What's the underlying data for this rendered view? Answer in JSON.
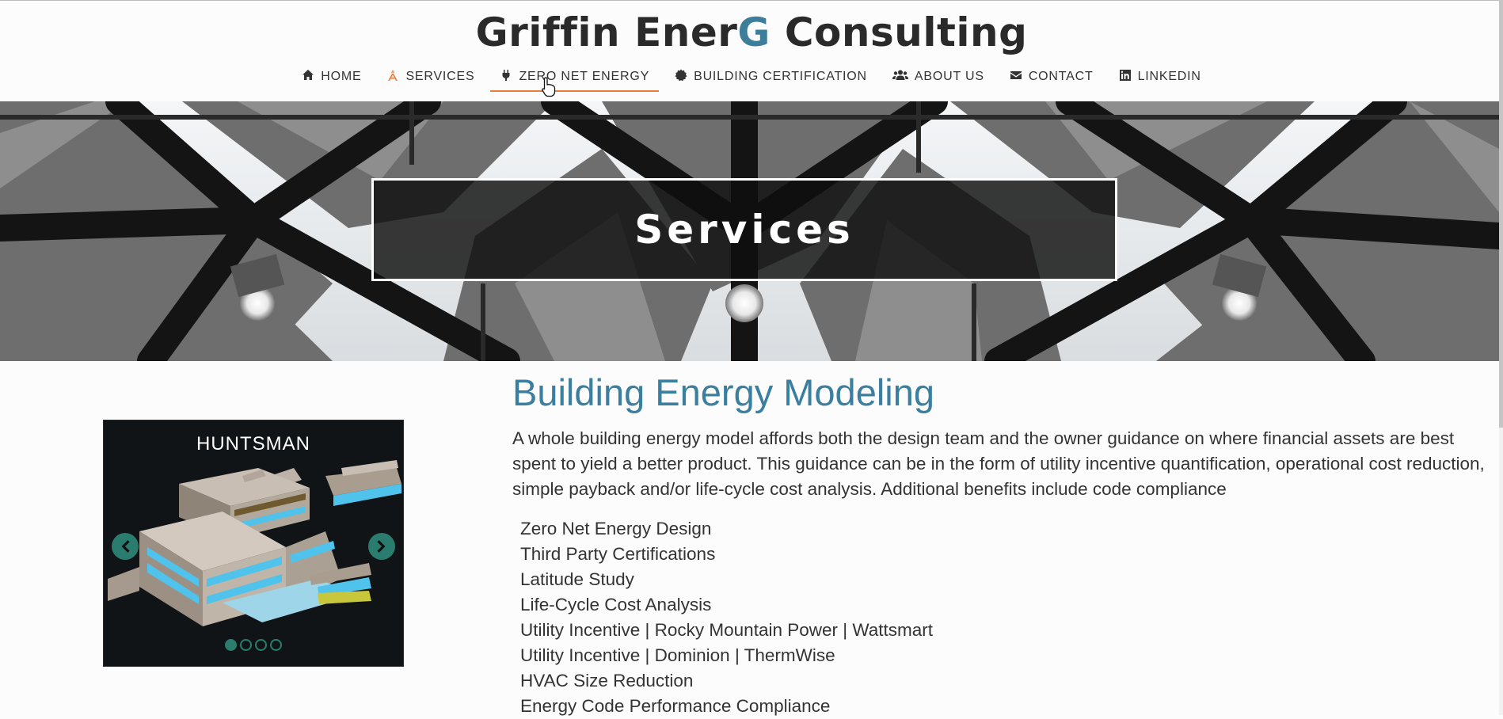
{
  "brand": {
    "prefix": "Griffin Ener",
    "highlight": "G",
    "suffix": " Consulting"
  },
  "nav": [
    {
      "label": "HOME",
      "icon": "home-icon"
    },
    {
      "label": "SERVICES",
      "icon": "compass-icon"
    },
    {
      "label": "ZERO NET ENERGY",
      "icon": "plug-icon"
    },
    {
      "label": "BUILDING CERTIFICATION",
      "icon": "certificate-icon"
    },
    {
      "label": "ABOUT US",
      "icon": "users-icon"
    },
    {
      "label": "CONTACT",
      "icon": "envelope-icon"
    },
    {
      "label": "LINKEDIN",
      "icon": "linkedin-icon"
    }
  ],
  "hero": {
    "title": "Services"
  },
  "carousel": {
    "caption": "HUNTSMAN",
    "slides": 4,
    "active_slide": 1
  },
  "section": {
    "heading": "Building Energy Modeling",
    "intro": "A whole building energy model affords both the design team and the owner guidance on where financial assets are best spent to yield a better product. This guidance can be in the form of utility incentive quantification, operational cost reduction, simple payback and/or life-cycle cost analysis. Additional benefits include code compliance",
    "items": [
      "Zero Net Energy Design",
      "Third Party Certifications",
      "Latitude Study",
      "Life-Cycle Cost Analysis",
      "Utility Incentive | Rocky Mountain Power | Wattsmart",
      "Utility Incentive | Dominion | ThermWise",
      "HVAC Size Reduction",
      "Energy Code Performance Compliance"
    ]
  },
  "colors": {
    "accent": "#3b7fa0",
    "nav_active": "#e8803c",
    "carousel_control": "#2a7d6e"
  }
}
